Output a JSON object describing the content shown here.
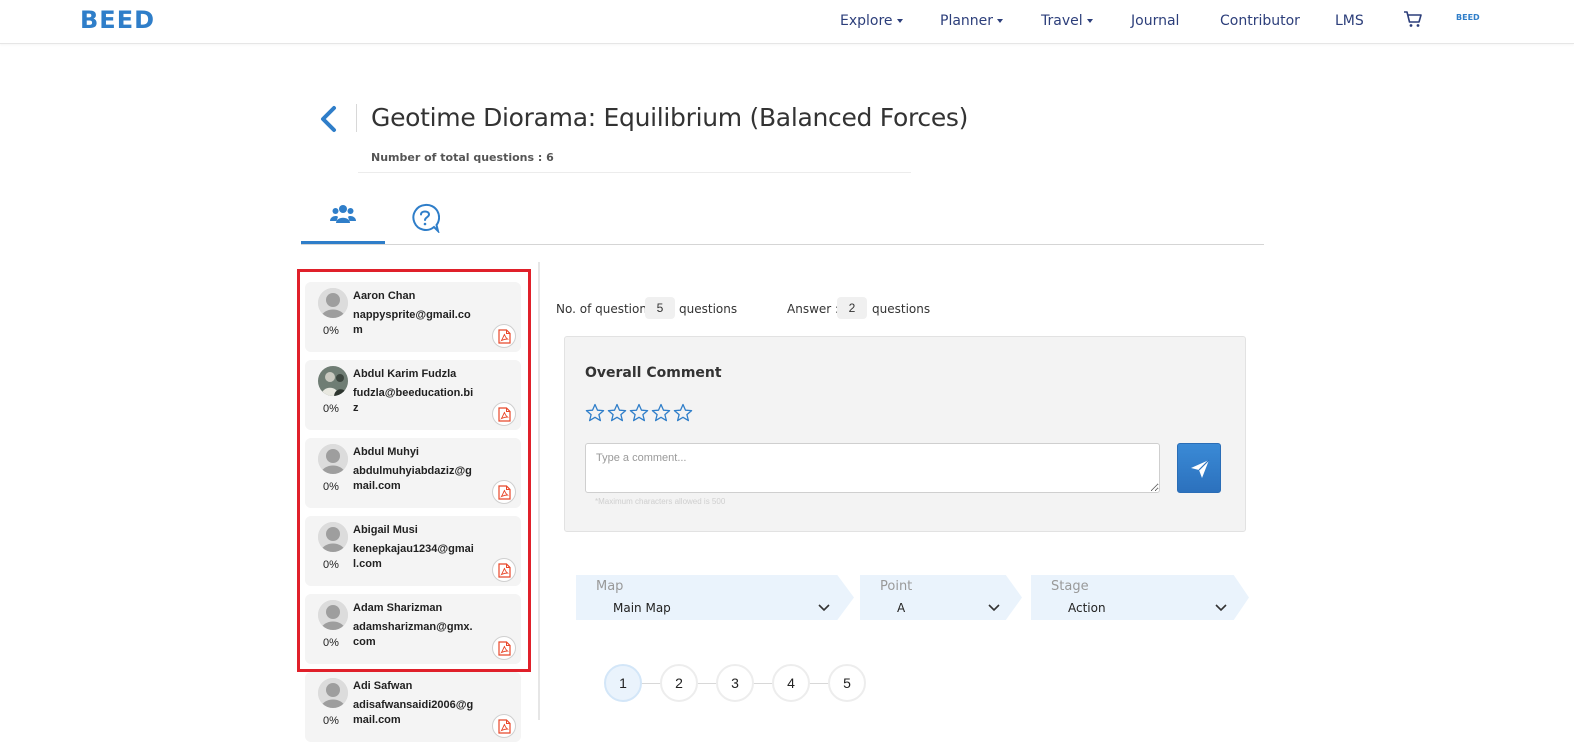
{
  "nav": {
    "logo": "BEED",
    "items": [
      {
        "label": "Explore",
        "dropdown": true
      },
      {
        "label": "Planner",
        "dropdown": true
      },
      {
        "label": "Travel",
        "dropdown": true
      },
      {
        "label": "Journal",
        "dropdown": false
      },
      {
        "label": "Contributor",
        "dropdown": false
      },
      {
        "label": "LMS",
        "dropdown": false
      }
    ],
    "cart_icon": "cart-icon",
    "profile_logo": "BEED"
  },
  "header": {
    "title": "Geotime Diorama: Equilibrium (Balanced Forces)",
    "total_questions": "Number of total questions : 6"
  },
  "tabs": [
    {
      "name": "students",
      "icon": "users-icon",
      "active": true
    },
    {
      "name": "questions",
      "icon": "question-icon",
      "active": false
    }
  ],
  "students": [
    {
      "name": "Aaron Chan",
      "email": "nappysprite@gmail.com",
      "progress": "0%",
      "avatar": "default"
    },
    {
      "name": "Abdul Karim Fudzla",
      "email": "fudzla@beeducation.biz",
      "progress": "0%",
      "avatar": "photo"
    },
    {
      "name": "Abdul Muhyi",
      "email": "abdulmuhyiabdaziz@gmail.com",
      "progress": "0%",
      "avatar": "default"
    },
    {
      "name": "Abigail Musi",
      "email": "kenepkajau1234@gmail.com",
      "progress": "0%",
      "avatar": "default"
    },
    {
      "name": "Adam Sharizman",
      "email": "adamsharizman@gmx.com",
      "progress": "0%",
      "avatar": "default"
    },
    {
      "name": "Adi Safwan",
      "email": "adisafwansaidi2006@gmail.com",
      "progress": "0%",
      "avatar": "default"
    }
  ],
  "summary": {
    "questions_label": "No. of question :",
    "questions_value": "5",
    "questions_unit": "questions",
    "answer_label": "Answer :",
    "answer_value": "2",
    "answer_unit": "questions"
  },
  "comment": {
    "title": "Overall Comment",
    "rating": 0,
    "max_rating": 5,
    "placeholder": "Type a comment...",
    "max_chars_note": "*Maximum characters allowed is 500"
  },
  "filters": [
    {
      "label": "Map",
      "value": "Main Map"
    },
    {
      "label": "Point",
      "value": "A"
    },
    {
      "label": "Stage",
      "value": "Action"
    }
  ],
  "pagination": {
    "pages": [
      "1",
      "2",
      "3",
      "4",
      "5"
    ],
    "active": "1"
  },
  "colors": {
    "brand": "#2f7ec9",
    "nav_text": "#2c3e7a",
    "highlight": "#e0202a",
    "pdf_red": "#e8472a"
  }
}
